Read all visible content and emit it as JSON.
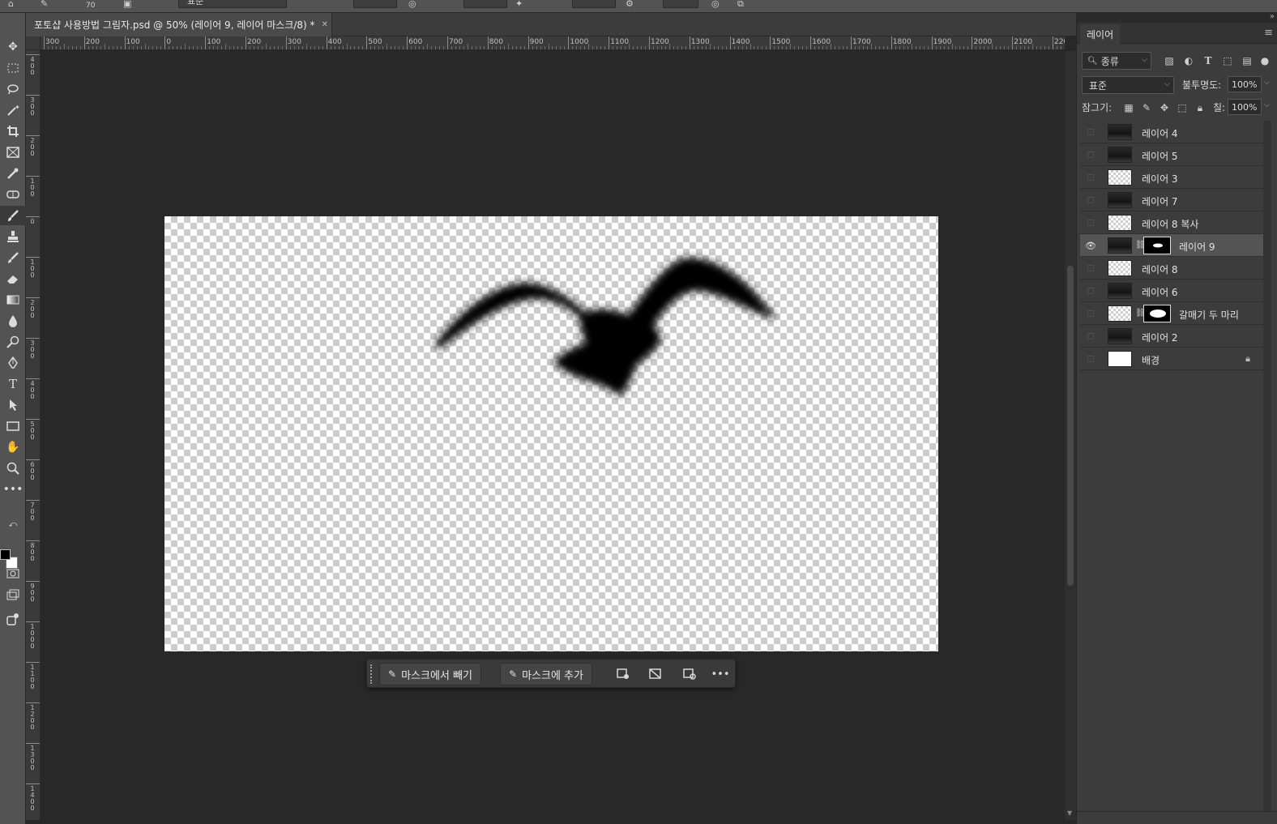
{
  "options_bar": {
    "brush_size": "70",
    "mode_value": "표준"
  },
  "document": {
    "tab_title": "포토샵 사용방법 그림자.psd @ 50% (레이어 9, 레이어 마스크/8) *"
  },
  "ruler_h": {
    "labels": [
      "300",
      "200",
      "100",
      "0",
      "100",
      "200",
      "300",
      "400",
      "500",
      "600",
      "700",
      "800",
      "900",
      "1000",
      "1100",
      "1200",
      "1300",
      "1400",
      "1500",
      "1600",
      "1700",
      "1800",
      "1900",
      "2000",
      "2100",
      "220"
    ]
  },
  "ruler_v": {
    "labels": [
      "4\n0\n0",
      "3\n0\n0",
      "2\n0\n0",
      "1\n0\n0",
      "0",
      "1\n0\n0",
      "2\n0\n0",
      "3\n0\n0",
      "4\n0\n0",
      "5\n0\n0",
      "6\n0\n0",
      "7\n0\n0",
      "8\n0\n0",
      "9\n0\n0",
      "1\n0\n0\n0",
      "1\n1\n0\n0",
      "1\n2\n0\n0",
      "1\n3\n0\n0",
      "1\n4\n0\n0"
    ]
  },
  "taskbar": {
    "subtract_label": "마스크에서 빼기",
    "add_label": "마스크에 추가"
  },
  "layers_panel": {
    "tab_label": "레이어",
    "filter_kind": "종류",
    "blend_mode": "표준",
    "opacity_label": "불투명도:",
    "opacity_value": "100%",
    "lock_label": "잠그기:",
    "fill_label": "칠:",
    "fill_value": "100%",
    "layers": [
      {
        "name": "레이어 4",
        "thumb": "dark",
        "visible": false,
        "selected": false,
        "mask": false,
        "locked": false
      },
      {
        "name": "레이어 5",
        "thumb": "dark",
        "visible": false,
        "selected": false,
        "mask": false,
        "locked": false
      },
      {
        "name": "레이어 3",
        "thumb": "trans",
        "visible": false,
        "selected": false,
        "mask": false,
        "locked": false
      },
      {
        "name": "레이어 7",
        "thumb": "dark",
        "visible": false,
        "selected": false,
        "mask": false,
        "locked": false
      },
      {
        "name": "레이어 8 복사",
        "thumb": "trans",
        "visible": false,
        "selected": false,
        "mask": false,
        "locked": false
      },
      {
        "name": "레이어 9",
        "thumb": "dark",
        "visible": true,
        "selected": true,
        "mask": true,
        "locked": false
      },
      {
        "name": "레이어 8",
        "thumb": "trans",
        "visible": false,
        "selected": false,
        "mask": false,
        "locked": false
      },
      {
        "name": "레이어 6",
        "thumb": "dark",
        "visible": false,
        "selected": false,
        "mask": false,
        "locked": false
      },
      {
        "name": "갈매기 두 마리",
        "thumb": "trans",
        "visible": false,
        "selected": false,
        "mask": true,
        "locked": false
      },
      {
        "name": "레이어 2",
        "thumb": "dark",
        "visible": false,
        "selected": false,
        "mask": false,
        "locked": false
      },
      {
        "name": "배경",
        "thumb": "white",
        "visible": false,
        "selected": false,
        "mask": false,
        "locked": true
      }
    ]
  },
  "colors": {
    "foreground": "#000000",
    "background": "#ffffff",
    "panel_bg": "#3c3c3c",
    "canvas_bg": "#282828"
  }
}
